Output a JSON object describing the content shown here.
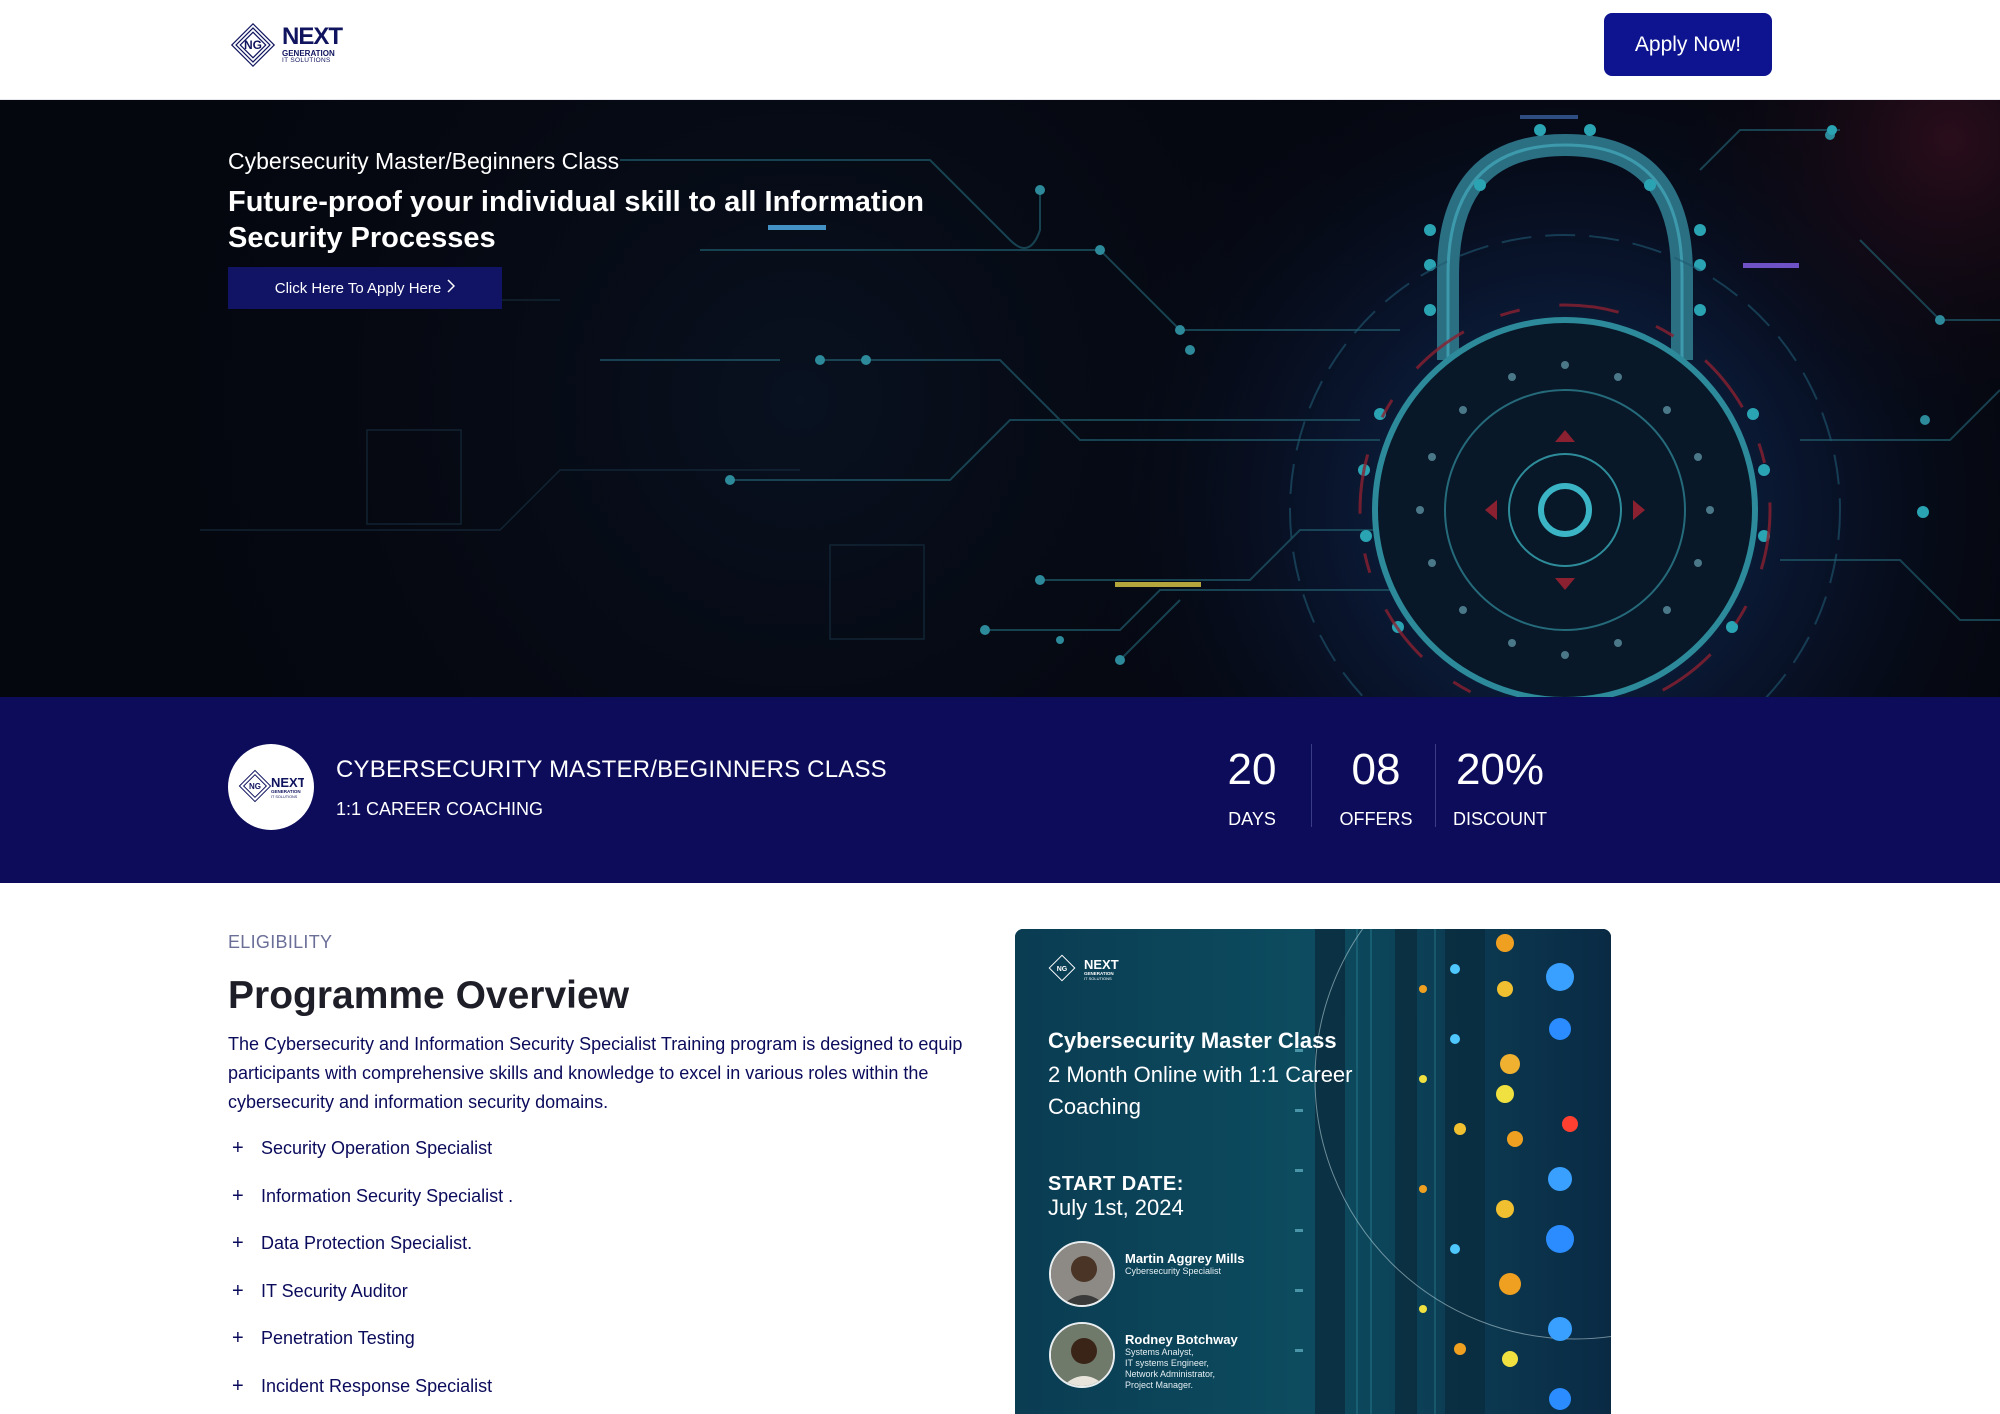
{
  "header": {
    "logo": {
      "mark": "NG",
      "name": "NEXT",
      "line2": "GENERATION",
      "line3": "IT SOLUTIONS"
    },
    "apply_label": "Apply Now!"
  },
  "hero": {
    "eyebrow": "Cybersecurity Master/Beginners Class",
    "title": "Future-proof your individual skill to all Information Security Processes",
    "cta_label": "Click Here To Apply Here",
    "cta_icon": "chevron-right-icon",
    "background": "padlock-circuit-illustration"
  },
  "banner": {
    "title": "CYBERSECURITY MASTER/BEGINNERS CLASS",
    "subtitle": "1:1 CAREER COACHING",
    "stats": [
      {
        "value": "20",
        "label": "DAYS"
      },
      {
        "value": "08",
        "label": "OFFERS"
      },
      {
        "value": "20%",
        "label": "DISCOUNT"
      }
    ]
  },
  "overview": {
    "eyebrow": "ELIGIBILITY",
    "title": "Programme Overview",
    "description": "The Cybersecurity and Information Security Specialist Training program is designed to equip participants with comprehensive skills and knowledge to excel in various roles within the cybersecurity and information security domains.",
    "roles": [
      "Security Operation Specialist",
      "Information Security Specialist .",
      "Data Protection Specialist.",
      "IT Security Auditor",
      "Penetration Testing",
      "Incident Response Specialist"
    ]
  },
  "poster": {
    "title": "Cybersecurity Master Class",
    "subtitle": "2 Month Online with 1:1 Career Coaching",
    "start_label": "START DATE:",
    "start_date": "July 1st, 2024",
    "people": [
      {
        "name": "Martin Aggrey Mills",
        "role": "Cybersecurity Specialist"
      },
      {
        "name": "Rodney Botchway",
        "role": "Systems Analyst,\nIT systems Engineer,\nNetwork Administrator,\nProject Manager."
      }
    ]
  },
  "colors": {
    "brand": "#0e148f",
    "banner": "#0c0c5a",
    "text": "#0b0b5c"
  }
}
